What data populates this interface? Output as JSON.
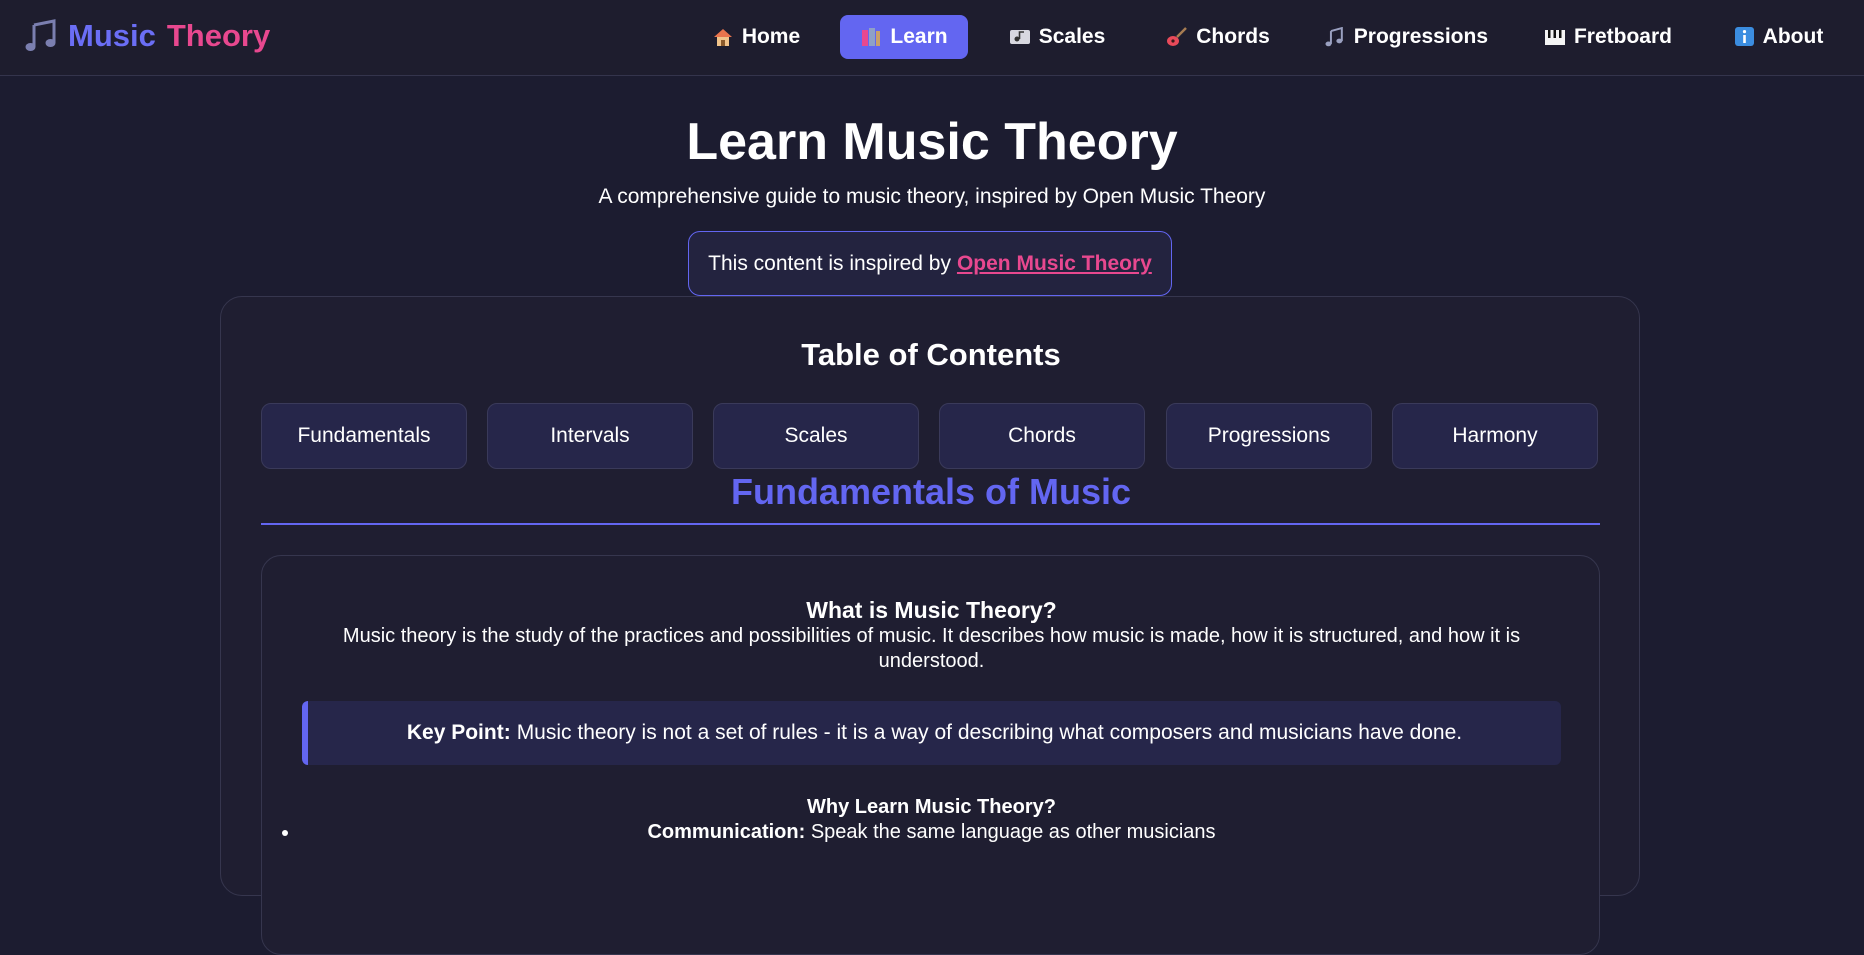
{
  "brand": {
    "part1": "Music",
    "part2": "Theory",
    "icon": "music-note-icon"
  },
  "nav": [
    {
      "label": "Home",
      "icon": "house-icon",
      "active": false
    },
    {
      "label": "Learn",
      "icon": "books-icon",
      "active": true
    },
    {
      "label": "Scales",
      "icon": "scale-icon",
      "active": false
    },
    {
      "label": "Chords",
      "icon": "guitar-icon",
      "active": false
    },
    {
      "label": "Progressions",
      "icon": "notes-icon",
      "active": false
    },
    {
      "label": "Fretboard",
      "icon": "piano-icon",
      "active": false
    },
    {
      "label": "About",
      "icon": "info-icon",
      "active": false
    }
  ],
  "hero": {
    "title": "Learn Music Theory",
    "subtitle": "A comprehensive guide to music theory, inspired by Open Music Theory"
  },
  "inspired": {
    "text": "This content is inspired by",
    "link": "Open Music Theory"
  },
  "toc": {
    "title": "Table of Contents",
    "items": [
      "Fundamentals",
      "Intervals",
      "Scales",
      "Chords",
      "Progressions",
      "Harmony"
    ]
  },
  "section": {
    "title": "Fundamentals of Music",
    "what_title": "What is Music Theory?",
    "what_body": "Music theory is the study of the practices and possibilities of music. It describes how music is made, how it is structured, and how it is understood.",
    "key_label": "Key Point:",
    "key_text": "Music theory is not a set of rules - it is a way of describing what composers and musicians have done.",
    "why_title": "Why Learn Music Theory?",
    "why_items": [
      {
        "label": "Communication:",
        "text": "Speak the same language as other musicians"
      }
    ]
  },
  "colors": {
    "accent": "#6366f1",
    "pink": "#e8488f",
    "bg": "#1c1c30"
  }
}
